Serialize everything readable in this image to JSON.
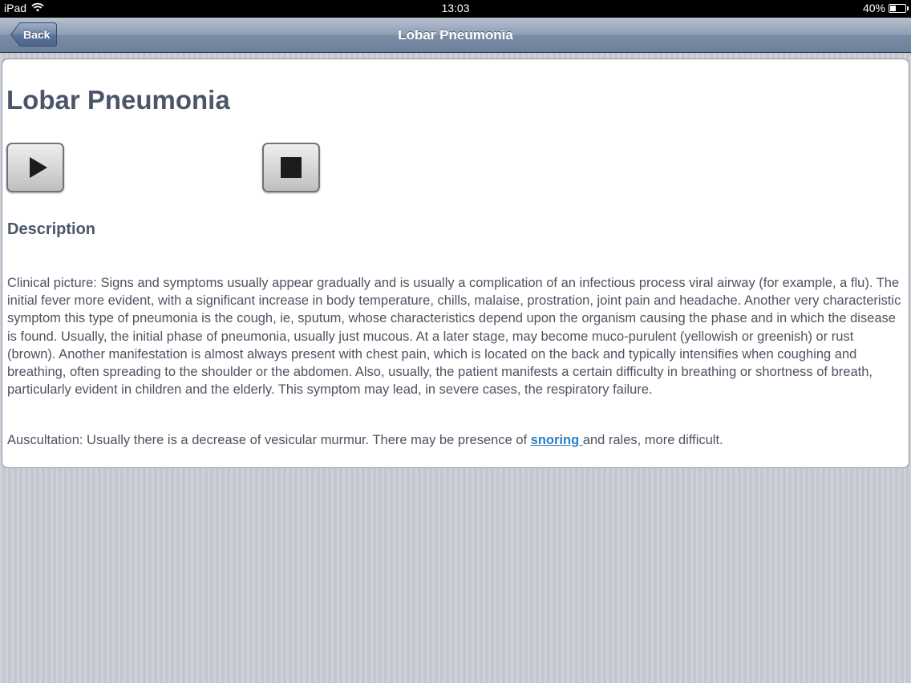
{
  "status_bar": {
    "carrier": "iPad",
    "time": "13:03",
    "battery_level": "40%",
    "battery_fraction": 0.4
  },
  "nav": {
    "title": "Lobar Pneumonia",
    "back_label": "Back"
  },
  "content": {
    "title": "Lobar Pneumonia",
    "media": {
      "play_icon": "play-icon",
      "stop_icon": "stop-icon"
    },
    "section_heading": "Description",
    "clinical_text": "Clinical picture: Signs and symptoms usually appear gradually and is usually a complication of an infectious process viral airway (for example, a flu). The initial fever more evident, with a significant increase in body temperature, chills, malaise, prostration, joint pain and headache. Another very characteristic symptom this type of pneumonia is the cough, ie, sputum, whose characteristics depend upon the organism causing the phase and in which the disease is found. Usually, the initial phase of pneumonia, usually just mucous. At a later stage, may become muco-purulent (yellowish or greenish) or rust (brown). Another manifestation is almost always present with chest pain, which is located on the back and typically intensifies when coughing and breathing, often spreading to the shoulder or the abdomen. Also, usually, the patient manifests a certain difficulty in breathing or shortness of breath, particularly evident in children and the elderly. This symptom may lead, in severe cases, the respiratory failure.",
    "auscultation_before": "Auscultation: Usually there is a decrease of vesicular murmur. There may be presence of ",
    "auscultation_link": "snoring ",
    "auscultation_after": "and rales, more difficult."
  },
  "colors": {
    "heading": "#4b566a",
    "body_text": "#4d5460",
    "link": "#2c7fc6"
  }
}
